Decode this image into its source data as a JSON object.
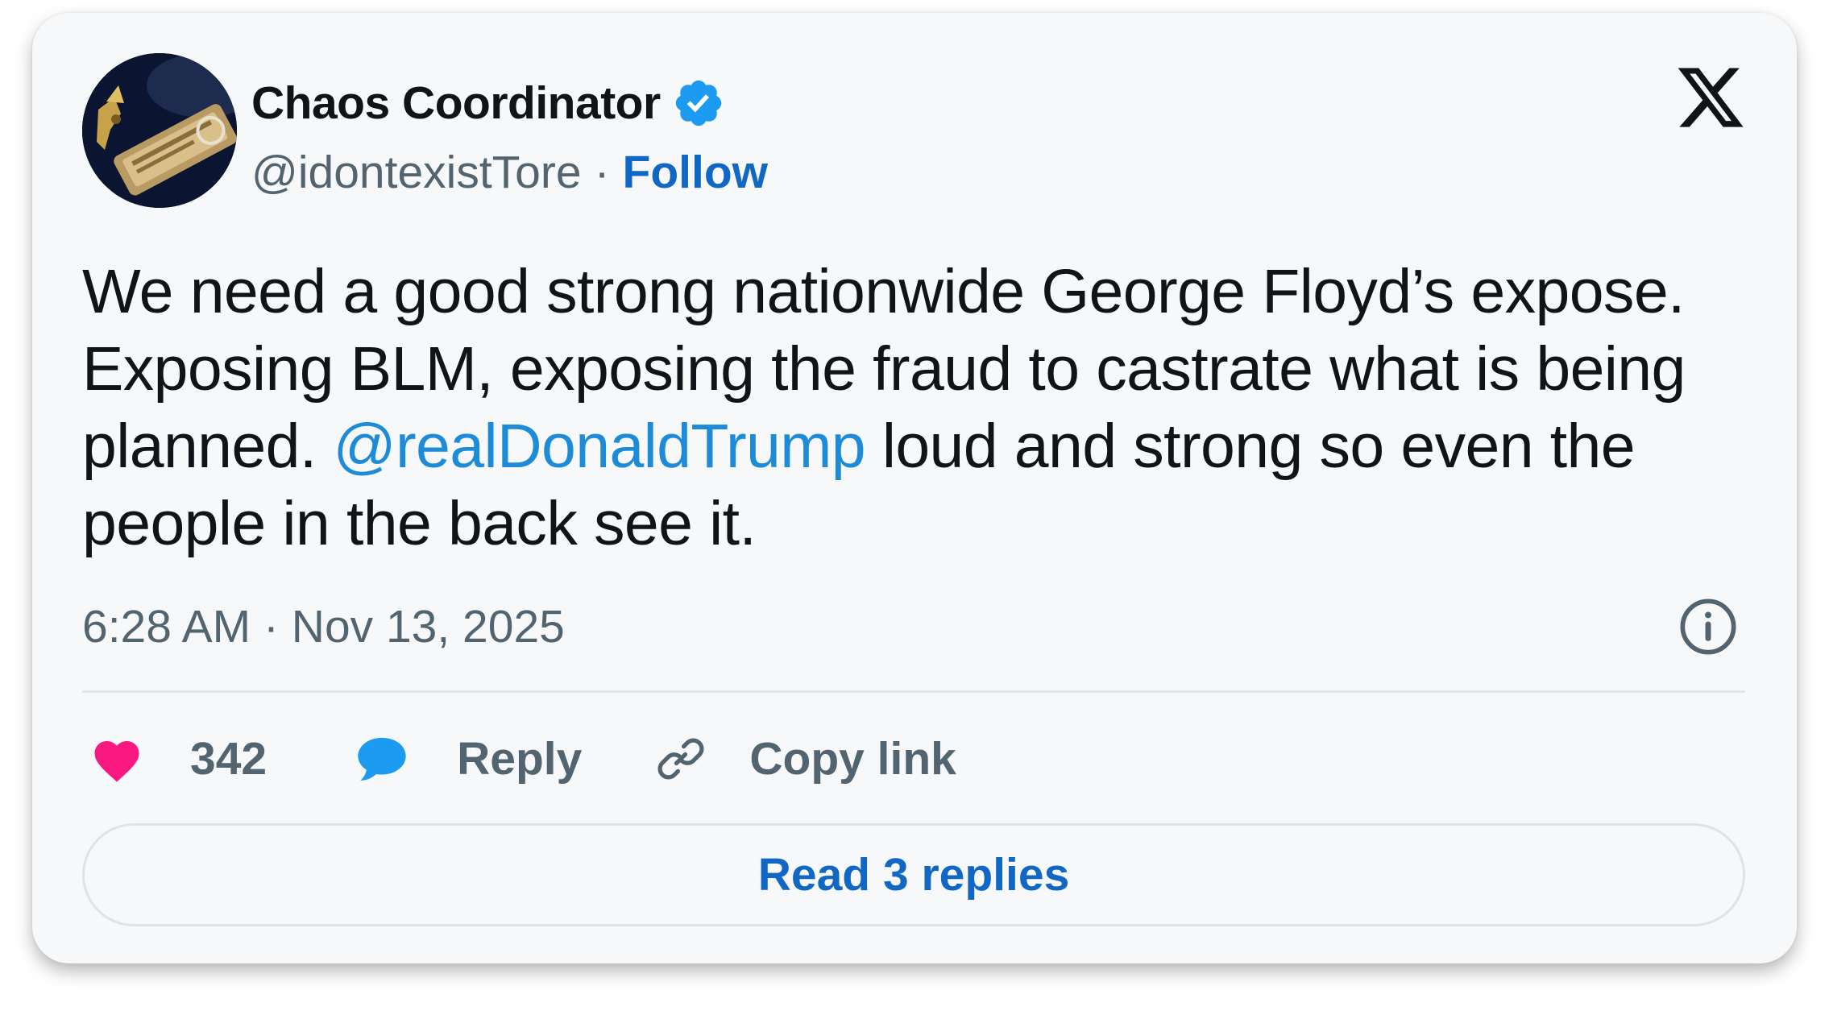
{
  "author": {
    "display_name": "Chaos Coordinator",
    "handle": "@idontexistTore",
    "separator": "·",
    "follow_label": "Follow",
    "verified": true,
    "verified_color": "#1d9bf0"
  },
  "brand": {
    "logo_icon": "x-logo-icon"
  },
  "tweet": {
    "text_part1": "We need a good strong nationwide George Floyd’s expose. Exposing BLM, exposing the fraud to castrate what is being planned. ",
    "mention": "@realDonaldTrump",
    "text_part2": " loud and strong so even the people in the back see it.",
    "timestamp": "6:28 AM · Nov 13, 2025",
    "mention_color": "#1d8bd8"
  },
  "actions": {
    "like_icon": "heart-icon",
    "like_count": "342",
    "like_color": "#f91880",
    "reply_icon": "speech-bubble-icon",
    "reply_label": "Reply",
    "reply_color": "#1d9bf0",
    "copy_icon": "link-icon",
    "copy_label": "Copy link"
  },
  "footer": {
    "read_replies_label": "Read 3 replies"
  }
}
